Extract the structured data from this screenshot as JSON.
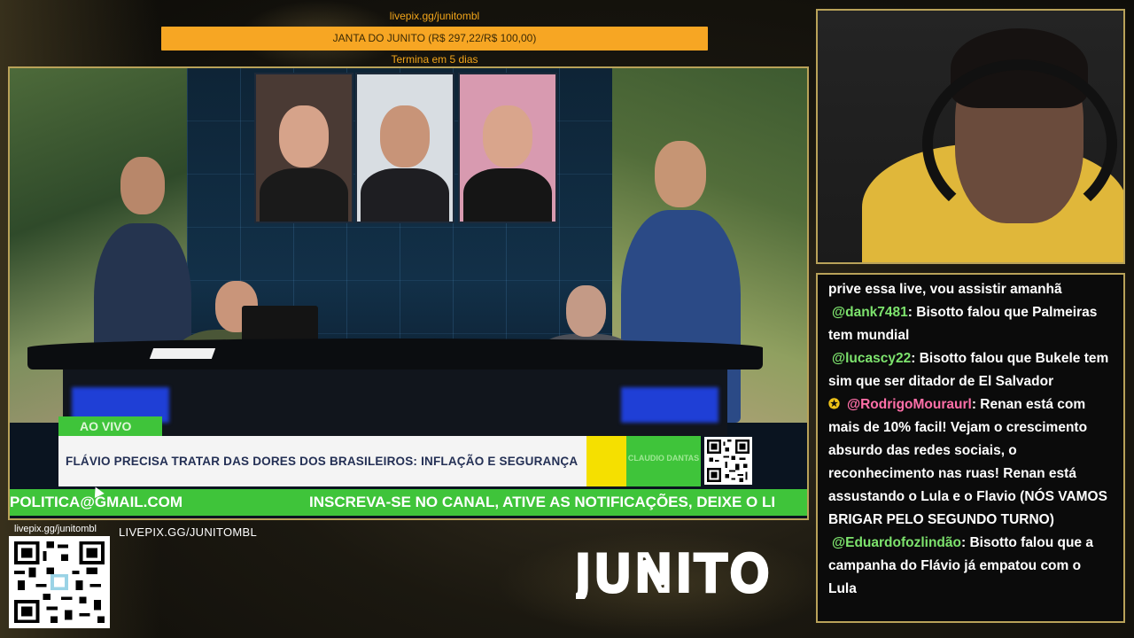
{
  "goal": {
    "url": "livepix.gg/junitombl",
    "label": "JANTA DO JUNITO (R$ 297,22/R$ 100,00)",
    "progress_percent": 100,
    "ends": "Termina em 5 dias",
    "bar_color": "#f7a623"
  },
  "broadcast": {
    "live_tag": "AO VIVO",
    "headline": "FLÁVIO PRECISA TRATAR DAS DORES DOS BRASILEIROS: INFLAÇÃO E SEGURANÇA",
    "brand_block": "CLAUDIO DANTAS",
    "ticker_left": "POLITICA@GMAIL.COM",
    "ticker_right": "INSCREVA-SE NO CANAL, ATIVE AS NOTIFICAÇÕES, DEIXE O LI",
    "accent_green": "#3fc43a",
    "accent_yellow": "#f5e000"
  },
  "chat": {
    "top_line": "prive essa live, vou assistir amanhã",
    "messages": [
      {
        "user": "@dank7481",
        "user_color": "#7de36d",
        "text": ": Bisotto falou que Palmeiras tem mundial",
        "badge": ""
      },
      {
        "user": "@lucascy22",
        "user_color": "#7de36d",
        "text": ": Bisotto falou que Bukele tem sim que ser ditador de El Salvador",
        "badge": ""
      },
      {
        "user": "@RodrigoMouraurl",
        "user_color": "#ff6fa8",
        "text": ": Renan está com mais de 10% facil! Vejam o crescimento absurdo das redes sociais, o reconhecimento nas ruas! Renan está assustando o Lula e o Flavio (NÓS VAMOS BRIGAR PELO SEGUNDO TURNO)",
        "badge": "star-icon"
      },
      {
        "user": "@Eduardofozlindão",
        "user_color": "#7de36d",
        "text": ": Bisotto falou que a campanha do Flávio já empatou com o Lula",
        "badge": ""
      }
    ]
  },
  "footer": {
    "qr_url": "livepix.gg/junitombl",
    "site_label": "LIVEPIX.GG/JUNITOMBL",
    "logo_text": "JUNITO"
  },
  "theme": {
    "frame_gold": "#b9a259",
    "goal_text": "#f2a51a"
  }
}
